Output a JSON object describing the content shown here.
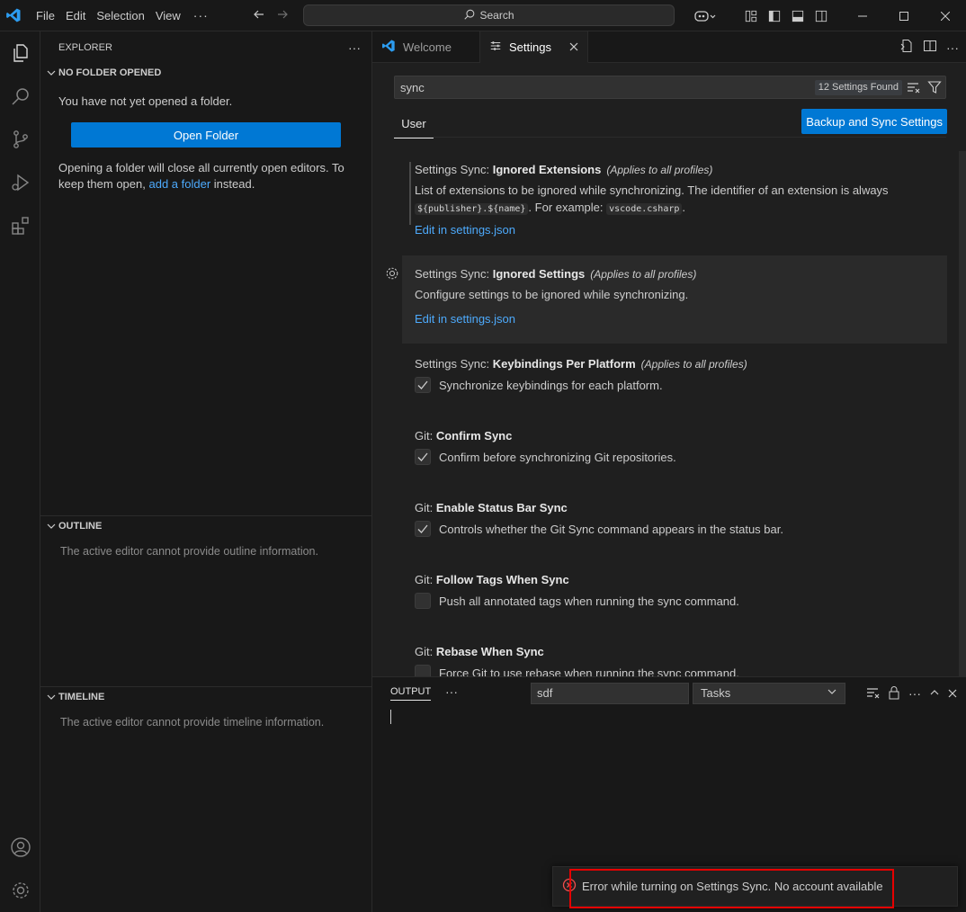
{
  "titlebar": {
    "menu": [
      {
        "label": "File"
      },
      {
        "label": "Edit"
      },
      {
        "label": "Selection"
      },
      {
        "label": "View"
      }
    ],
    "more": "···",
    "search": "Search"
  },
  "sidebar": {
    "header": "EXPLORER",
    "header_more": "···",
    "no_folder_title": "NO FOLDER OPENED",
    "no_folder_text": "You have not yet opened a folder.",
    "open_folder_button": "Open Folder",
    "info_text_1": "Opening a folder will close all currently open editors. To keep them open,",
    "info_link": "add a folder",
    "info_text_2": "instead.",
    "outline_title": "OUTLINE",
    "outline_text": "The active editor cannot provide outline information.",
    "timeline_title": "TIMELINE",
    "timeline_text": "The active editor cannot provide timeline information."
  },
  "tabs": [
    {
      "label": "Welcome"
    },
    {
      "label": "Settings"
    }
  ],
  "settings": {
    "search_value": "sync",
    "found_badge": "12 Settings Found",
    "scope_tab": "User",
    "backup_button": "Backup and Sync Settings",
    "items": [
      {
        "category": "Settings Sync: ",
        "name": "Ignored Extensions",
        "scope": "(Applies to all profiles)",
        "desc_a": "List of extensions to be ignored while synchronizing. The identifier of an extension is always",
        "code1": "${publisher}.${name}",
        "desc_b": ". For example: ",
        "code2": "vscode.csharp",
        "desc_c": ".",
        "link": "Edit in settings.json"
      },
      {
        "category": "Settings Sync: ",
        "name": "Ignored Settings",
        "scope": "(Applies to all profiles)",
        "desc": "Configure settings to be ignored while synchronizing.",
        "link": "Edit in settings.json"
      },
      {
        "category": "Settings Sync: ",
        "name": "Keybindings Per Platform",
        "scope": "(Applies to all profiles)",
        "checkbox_label": "Synchronize keybindings for each platform.",
        "checked": true
      },
      {
        "category": "Git: ",
        "name": "Confirm Sync",
        "checkbox_label": "Confirm before synchronizing Git repositories.",
        "checked": true
      },
      {
        "category": "Git: ",
        "name": "Enable Status Bar Sync",
        "checkbox_label": "Controls whether the Git Sync command appears in the status bar.",
        "checked": true
      },
      {
        "category": "Git: ",
        "name": "Follow Tags When Sync",
        "checkbox_label": "Push all annotated tags when running the sync command.",
        "checked": false
      },
      {
        "category": "Git: ",
        "name": "Rebase When Sync",
        "checkbox_label": "Force Git to use rebase when running the sync command.",
        "checked": false
      }
    ]
  },
  "panel": {
    "tab": "OUTPUT",
    "more": "···",
    "filter_value": "sdf",
    "channel": "Tasks"
  },
  "notification": {
    "message": "Error while turning on Settings Sync. No account available",
    "icon": "error-icon",
    "highlight_color": "#e60000"
  },
  "colors": {
    "accent": "#0078d4",
    "link": "#4daafc"
  }
}
